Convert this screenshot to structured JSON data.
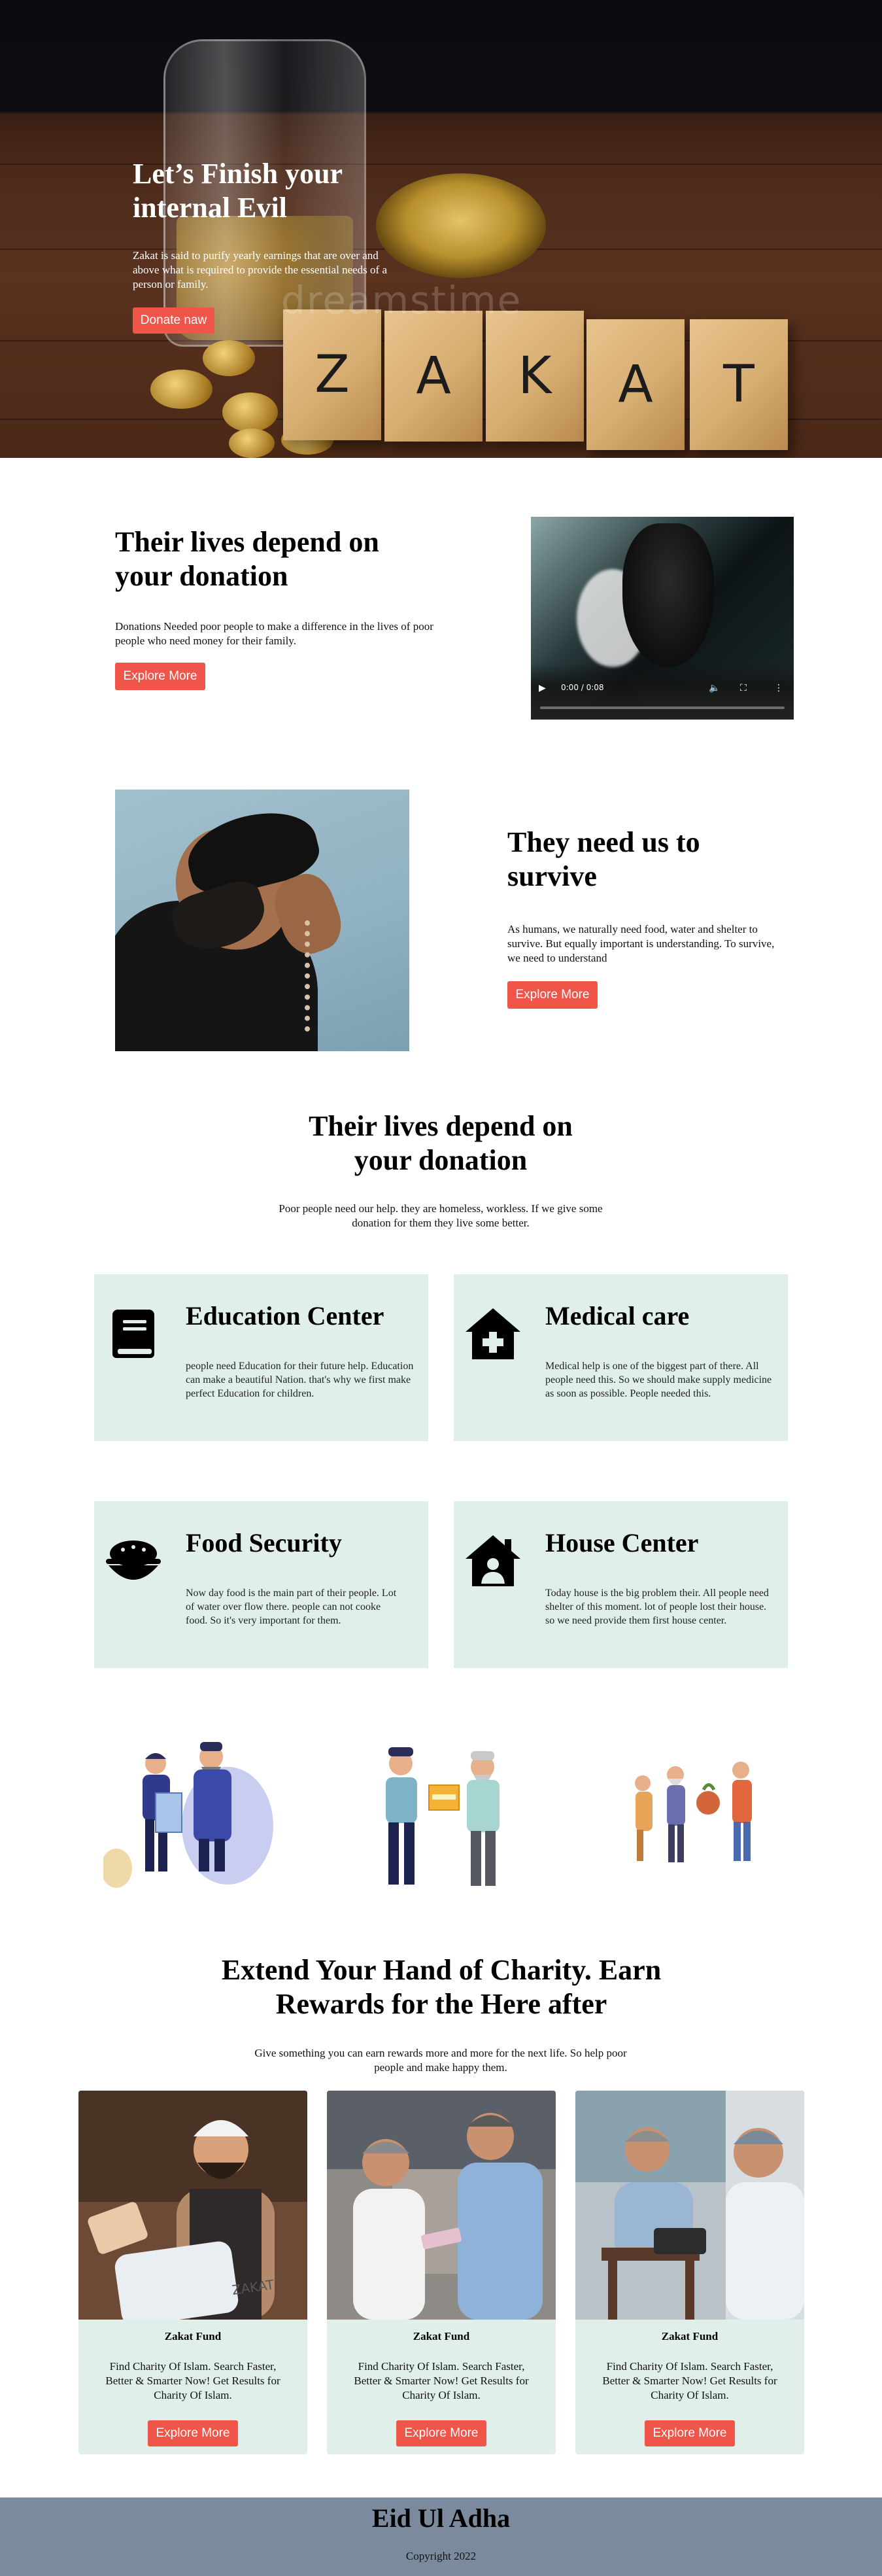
{
  "hero": {
    "title": "Let’s Finish your internal Evil",
    "description": "Zakat is said to purify yearly earnings that are over and above what is required to provide the essential needs of a person or family.",
    "button": "Donate naw",
    "blocks": [
      "Z",
      "A",
      "K",
      "A",
      "T"
    ],
    "watermark": "dreamstime"
  },
  "section1": {
    "title": "Their lives depend on your donation",
    "text": "Donations Needed poor people to make a difference in the lives of poor people who need money for their family.",
    "button": "Explore More",
    "video": {
      "time": "0:00 / 0:08"
    }
  },
  "section2": {
    "title": "They need us to survive",
    "text": "As humans, we naturally need food, water and shelter to survive. But equally important is understanding. To survive, we need to understand",
    "button": "Explore More"
  },
  "section3": {
    "title": "Their lives depend on your donation",
    "text": "Poor people need our help. they are homeless, workless. If we give some donation for them they live some better."
  },
  "services": [
    {
      "icon": "book-icon",
      "title": "Education Center",
      "text": "people need Education for their future help. Education can make a beautiful Nation. that's why we first make perfect Education for children."
    },
    {
      "icon": "medical-house-icon",
      "title": "Medical care",
      "text": "Medical help is one of the biggest part of there. All people need this. So we should make supply medicine as soon as possible. People needed this."
    },
    {
      "icon": "food-bowl-icon",
      "title": "Food Security",
      "text": "Now day food is the main part of their people. Lot of water over flow there. people can not cooke food. So it's very important for them."
    },
    {
      "icon": "house-user-icon",
      "title": "House Center",
      "text": "Today house is the big problem their. All people need shelter of this moment. lot of people lost their house. so we need provide them first house center."
    }
  ],
  "charity": {
    "title": "Extend Your Hand of Charity. Earn Rewards for the Here after",
    "text": "Give something you can earn rewards more and more for the next life. So help poor people and make happy them."
  },
  "funds": [
    {
      "title": "Zakat Fund",
      "text": "Find Charity Of Islam. Search Faster, Better & Smarter Now! Get Results for Charity Of Islam.",
      "button": "Explore More",
      "sack_text": "ZAKAT"
    },
    {
      "title": "Zakat Fund",
      "text": "Find Charity Of Islam. Search Faster, Better & Smarter Now! Get Results for Charity Of Islam.",
      "button": "Explore More"
    },
    {
      "title": "Zakat Fund",
      "text": "Find Charity Of Islam. Search Faster, Better & Smarter Now! Get Results for Charity Of Islam.",
      "button": "Explore More"
    }
  ],
  "footer": {
    "title": "Eid Ul Adha",
    "copyright": "Copyright 2022"
  },
  "colors": {
    "accent": "#f0554a",
    "card_bg": "#e0efea",
    "footer_bg": "#7b8b9d"
  }
}
